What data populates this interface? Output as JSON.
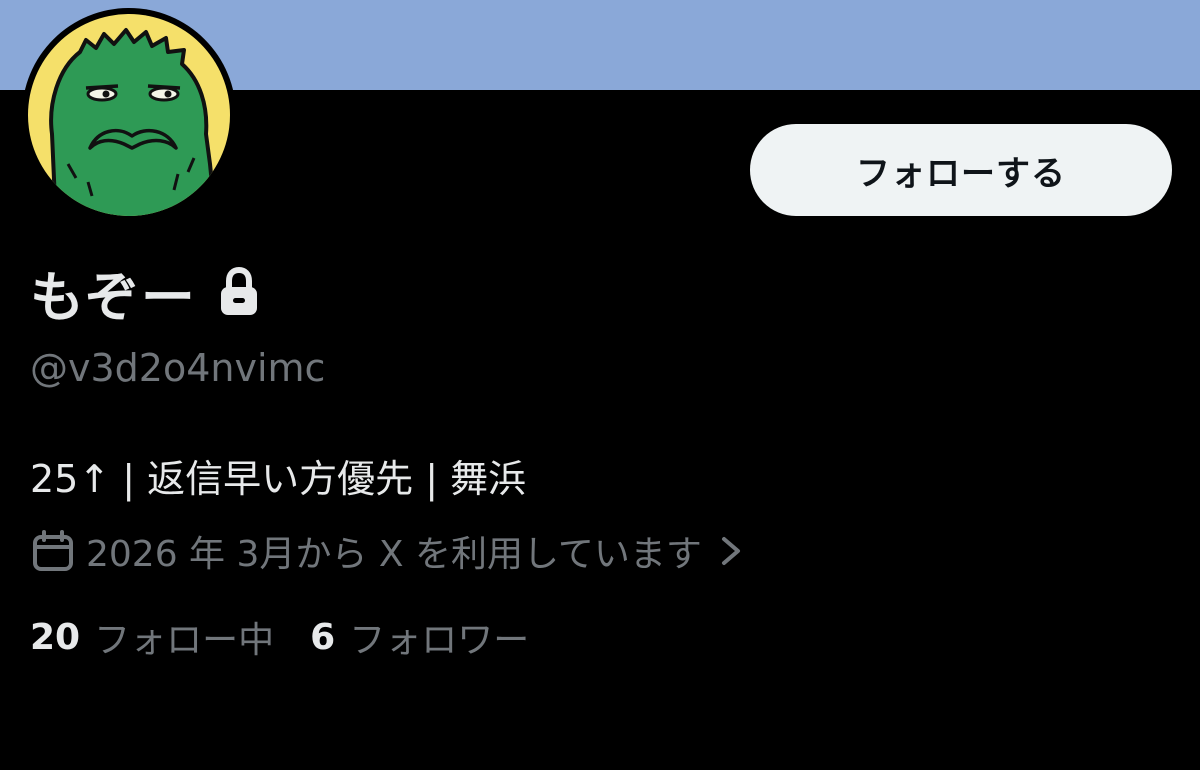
{
  "profile": {
    "display_name": "もぞー",
    "handle": "@v3d2o4nvimc",
    "bio": "25↑ | 返信早い方優先 | 舞浜",
    "joined": "2026 年 3月から X を利用しています",
    "follow_label": "フォローする",
    "following_count": "20",
    "following_label": "フォロー中",
    "followers_count": "6",
    "followers_label": "フォロワー"
  },
  "icons": {
    "lock": "lock-icon",
    "calendar": "calendar-icon",
    "chevron": "chevron-right-icon"
  },
  "colors": {
    "background": "#000000",
    "banner": "#8aa8d8",
    "primary_text": "#e7e9ea",
    "secondary_text": "#71767b",
    "follow_button_bg": "#eff3f4",
    "follow_button_text": "#0f1419",
    "avatar_bg": "#f5e06a",
    "avatar_character": "#2e9a55"
  }
}
